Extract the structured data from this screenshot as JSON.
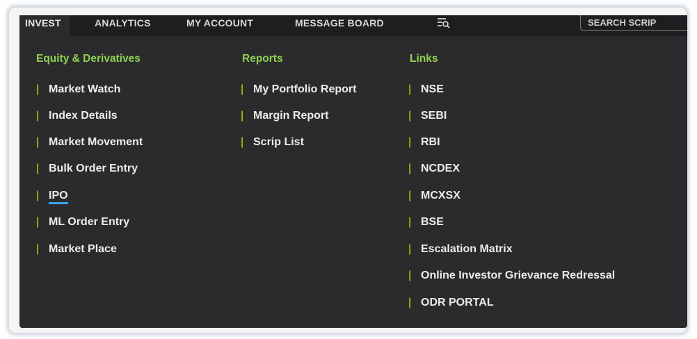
{
  "nav": {
    "tabs": [
      "INVEST",
      "ANALYTICS",
      "MY ACCOUNT",
      "MESSAGE BOARD"
    ],
    "menu_icon": "filter-list-icon",
    "search_placeholder": "SEARCH SCRIP"
  },
  "columns": [
    {
      "heading": "Equity & Derivatives",
      "items": [
        "Market Watch",
        "Index Details",
        "Market Movement",
        "Bulk Order Entry",
        "IPO",
        "ML Order Entry",
        "Market Place"
      ],
      "highlighted_item": "IPO"
    },
    {
      "heading": "Reports",
      "items": [
        "My Portfolio Report",
        "Margin Report",
        "Scrip List"
      ]
    },
    {
      "heading": "Links",
      "items": [
        "NSE",
        "SEBI",
        "RBI",
        "NCDEX",
        "MCXSX",
        "BSE",
        "Escalation Matrix",
        "Online Investor Grievance Redressal",
        "ODR PORTAL"
      ]
    }
  ],
  "colors": {
    "panel_bg": "#2b2b2e",
    "topbar_bg": "#1e1e20",
    "heading": "#8fd14f",
    "separator": "#c7e600",
    "link_text": "#ececec",
    "active_underline": "#3aa6f0"
  }
}
